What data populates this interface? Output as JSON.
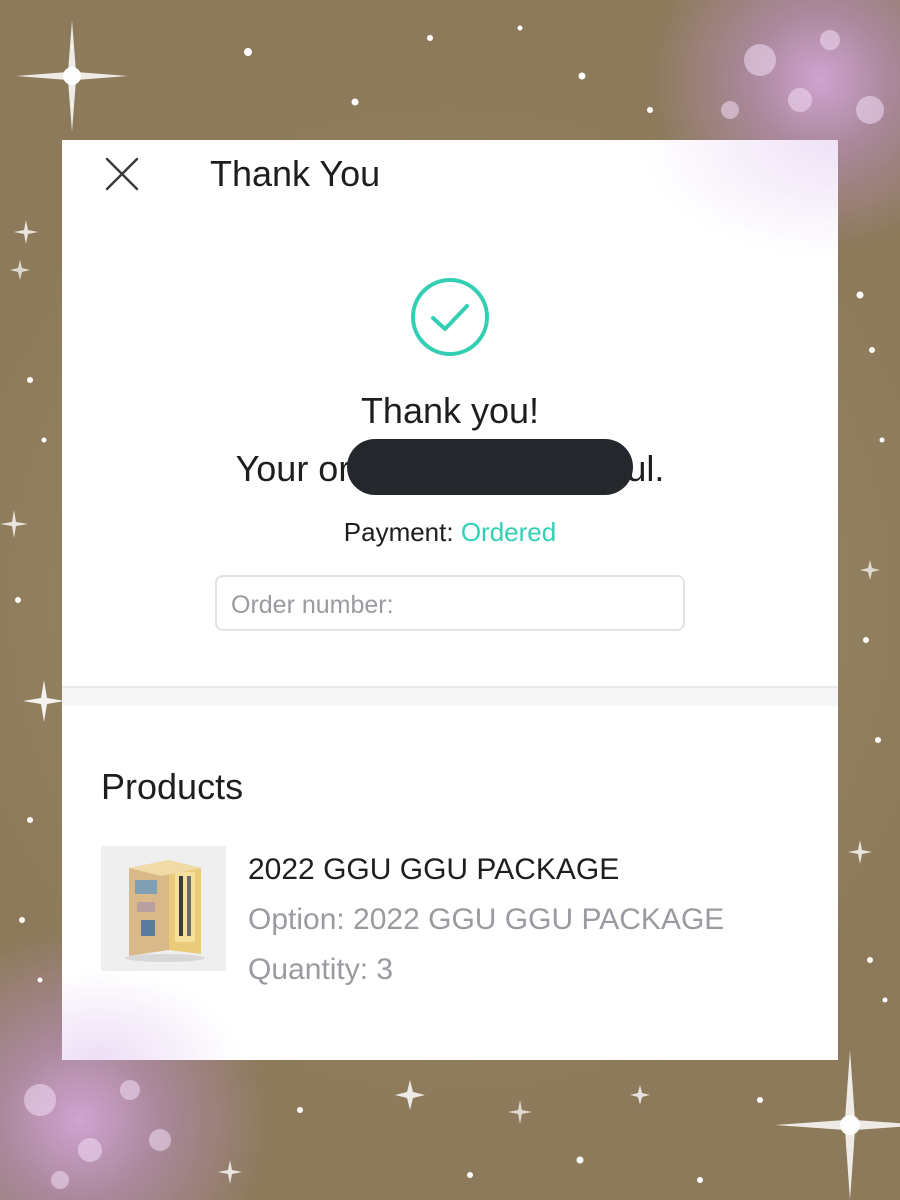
{
  "header": {
    "title": "Thank You",
    "close_icon": "close-icon"
  },
  "confirmation": {
    "icon": "check-circle-icon",
    "line1": "Thank you!",
    "line2": "Your order was successful.",
    "payment_label": "Payment:",
    "payment_status": "Ordered",
    "order_number_label": "Order number:"
  },
  "products": {
    "section_title": "Products",
    "items": [
      {
        "name": "2022 GGU GGU PACKAGE",
        "option": "Option: 2022 GGU GGU PACKAGE",
        "quantity": "Quantity: 3",
        "thumbnail_icon": "product-box-image"
      }
    ]
  },
  "colors": {
    "accent": "#33cfb4",
    "text": "#1e1e1e",
    "muted": "#9a9aa0",
    "background": "#8c7a5a"
  }
}
